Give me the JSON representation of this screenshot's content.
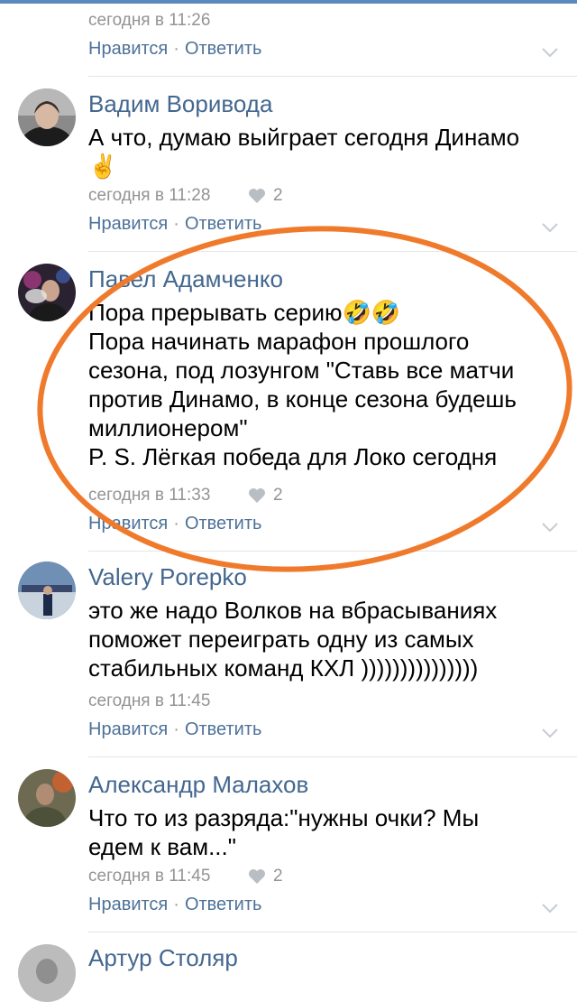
{
  "comments": [
    {
      "time": "сегодня в 11:26",
      "like_label": "Нравится",
      "sep": "·",
      "reply_label": "Ответить"
    },
    {
      "author": "Вадим Воривода",
      "text": [
        "А что, думаю выйграет сегодня Динамо",
        "✌️"
      ],
      "time": "сегодня в 11:28",
      "likes": "2",
      "like_label": "Нравится",
      "sep": "·",
      "reply_label": "Ответить"
    },
    {
      "author": "Павел Адамченко",
      "text": [
        "Пора прерывать серию🤣🤣",
        "Пора начинать марафон прошлого",
        "сезона, под лозунгом \"Ставь все матчи",
        "против Динамо, в конце сезона будешь",
        "миллионером\"",
        "P. S. Лёгкая победа для Локо сегодня"
      ],
      "time": "сегодня в 11:33",
      "likes": "2",
      "like_label": "Нравится",
      "sep": "·",
      "reply_label": "Ответить"
    },
    {
      "author": "Valery Porepko",
      "text": [
        "это же надо Волков на вбрасываниях",
        "поможет переиграть одну из самых",
        "стабильных команд КХЛ )))))))))))))))"
      ],
      "time": "сегодня в 11:45",
      "like_label": "Нравится",
      "sep": "·",
      "reply_label": "Ответить"
    },
    {
      "author": "Александр Малахов",
      "text": [
        "Что то из разряда:\"нужны очки? Мы",
        "едем к вам...\""
      ],
      "time": "сегодня в 11:45",
      "likes": "2",
      "like_label": "Нравится",
      "sep": "·",
      "reply_label": "Ответить"
    },
    {
      "author": "Артур Столяр"
    }
  ],
  "colors": {
    "author": "#43678f",
    "action": "#4d7198",
    "meta": "#939393",
    "highlight": "#f07a2c"
  },
  "icons": [
    "heart-icon",
    "chevron-down-icon"
  ]
}
